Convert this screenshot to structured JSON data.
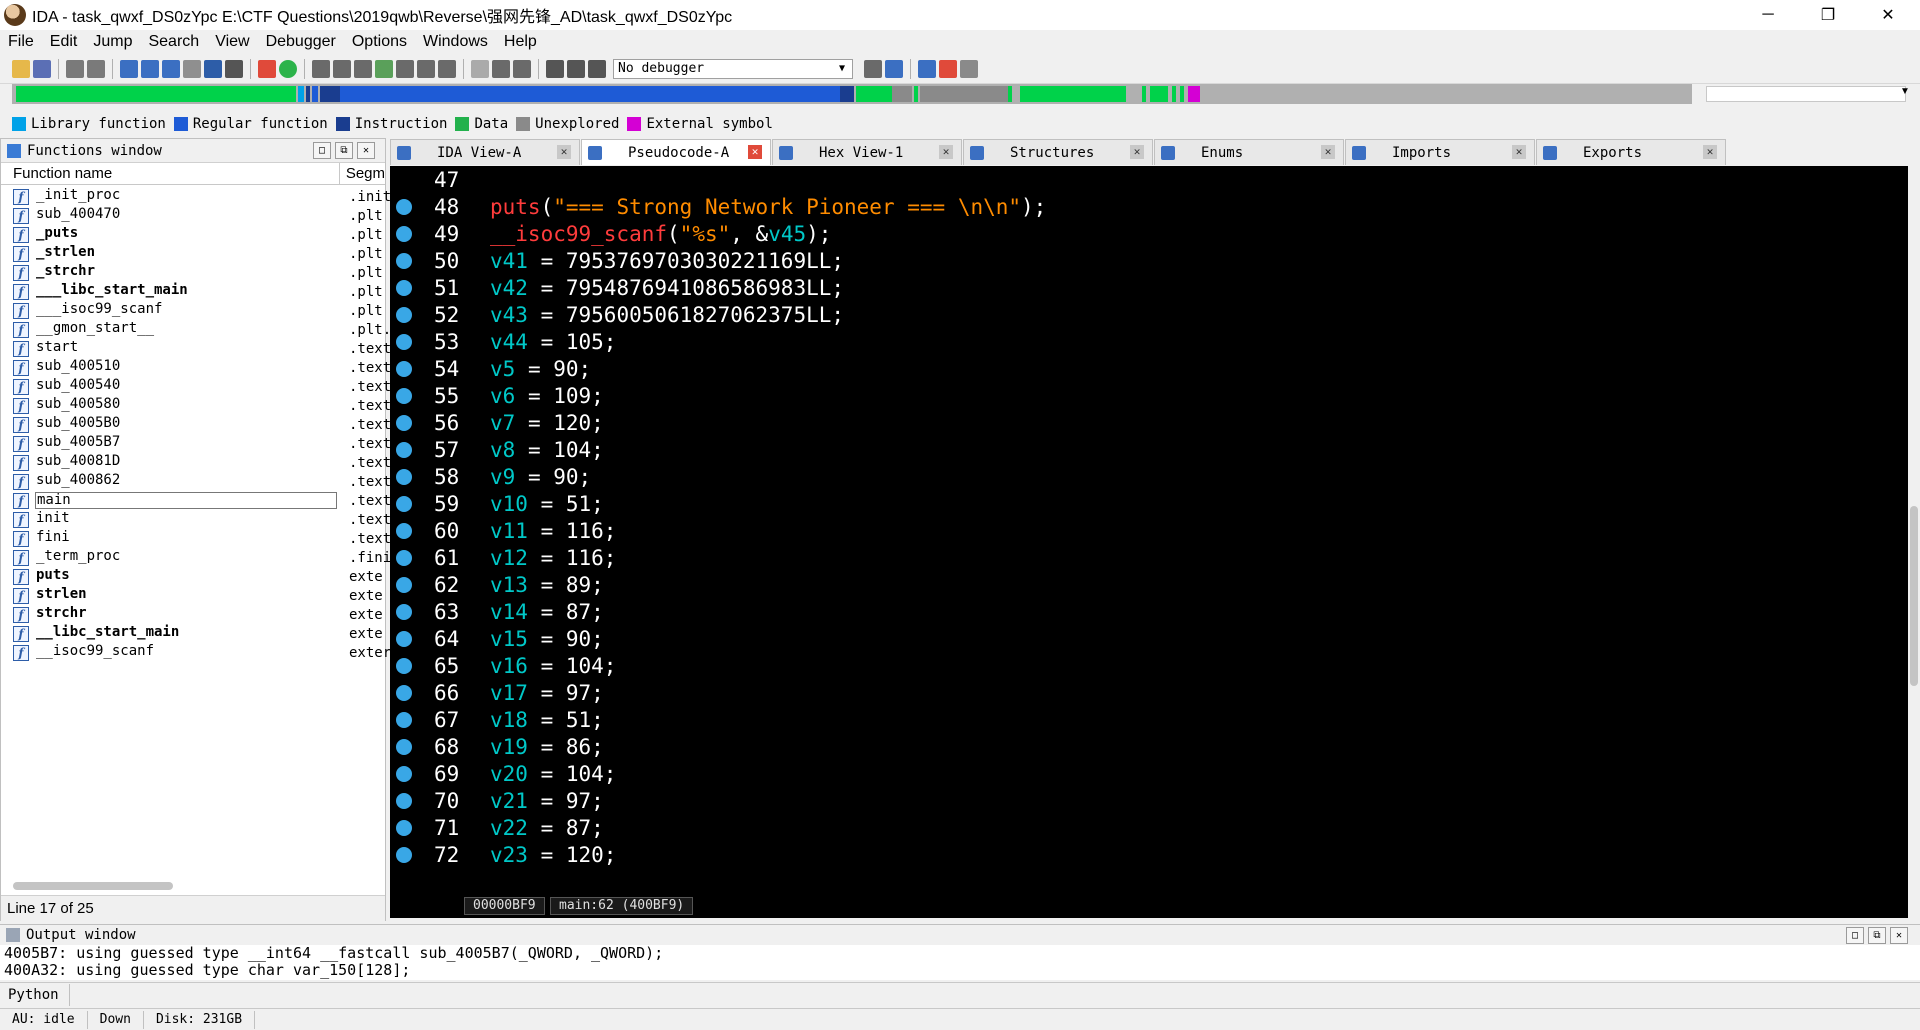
{
  "window": {
    "title": "IDA - task_qwxf_DS0zYpc E:\\CTF Questions\\2019qwb\\Reverse\\强网先锋_AD\\task_qwxf_DS0zYpc",
    "minimize": "─",
    "maximize": "❐",
    "close": "✕"
  },
  "menu": [
    "File",
    "Edit",
    "Jump",
    "Search",
    "View",
    "Debugger",
    "Options",
    "Windows",
    "Help"
  ],
  "toolbar": {
    "debugger_selected": "No debugger"
  },
  "legend": [
    {
      "label": "Library function",
      "color": "#00a2e8"
    },
    {
      "label": "Regular function",
      "color": "#1e5bd6"
    },
    {
      "label": "Instruction",
      "color": "#1a3d8f"
    },
    {
      "label": "Data",
      "color": "#22b14c"
    },
    {
      "label": "Unexplored",
      "color": "#8a8a8a"
    },
    {
      "label": "External symbol",
      "color": "#d400d4"
    }
  ],
  "functions_window": {
    "title": "Functions window",
    "col_name": "Function name",
    "col_segment": "Segm",
    "status": "Line 17 of 25",
    "rows": [
      {
        "name": "_init_proc",
        "seg": ".init",
        "bold": false
      },
      {
        "name": "sub_400470",
        "seg": ".plt",
        "bold": false
      },
      {
        "name": "_puts",
        "seg": ".plt",
        "bold": true
      },
      {
        "name": "_strlen",
        "seg": ".plt",
        "bold": true
      },
      {
        "name": "_strchr",
        "seg": ".plt",
        "bold": true
      },
      {
        "name": "___libc_start_main",
        "seg": ".plt",
        "bold": true
      },
      {
        "name": "___isoc99_scanf",
        "seg": ".plt",
        "bold": false
      },
      {
        "name": "__gmon_start__",
        "seg": ".plt.",
        "bold": false
      },
      {
        "name": "start",
        "seg": ".text",
        "bold": false
      },
      {
        "name": "sub_400510",
        "seg": ".text",
        "bold": false
      },
      {
        "name": "sub_400540",
        "seg": ".text",
        "bold": false
      },
      {
        "name": "sub_400580",
        "seg": ".text",
        "bold": false
      },
      {
        "name": "sub_4005B0",
        "seg": ".text",
        "bold": false
      },
      {
        "name": "sub_4005B7",
        "seg": ".text",
        "bold": false
      },
      {
        "name": "sub_40081D",
        "seg": ".text",
        "bold": false
      },
      {
        "name": "sub_400862",
        "seg": ".text",
        "bold": false
      },
      {
        "name": "main",
        "seg": ".text",
        "bold": false,
        "selected": true
      },
      {
        "name": "init",
        "seg": ".text",
        "bold": false
      },
      {
        "name": "fini",
        "seg": ".text",
        "bold": false
      },
      {
        "name": "_term_proc",
        "seg": ".fini",
        "bold": false
      },
      {
        "name": "puts",
        "seg": "exte",
        "bold": true
      },
      {
        "name": "strlen",
        "seg": "exte",
        "bold": true
      },
      {
        "name": "strchr",
        "seg": "exte",
        "bold": true
      },
      {
        "name": "__libc_start_main",
        "seg": "exte",
        "bold": true
      },
      {
        "name": "__isoc99_scanf",
        "seg": "exter",
        "bold": false
      }
    ]
  },
  "tabs": [
    {
      "label": "IDA View-A",
      "active": false
    },
    {
      "label": "Pseudocode-A",
      "active": true
    },
    {
      "label": "Hex View-1",
      "active": false
    },
    {
      "label": "Structures",
      "active": false
    },
    {
      "label": "Enums",
      "active": false
    },
    {
      "label": "Imports",
      "active": false
    },
    {
      "label": "Exports",
      "active": false
    }
  ],
  "colors": {
    "func": "#ff3c3c",
    "string": "#ff8c00",
    "var": "#00c8c8",
    "plain": "#ffffff",
    "number": "#ffffff"
  },
  "code_lines": [
    {
      "n": "47",
      "bp": false,
      "tokens": []
    },
    {
      "n": "48",
      "bp": true,
      "tokens": [
        [
          "puts",
          "func"
        ],
        [
          "(",
          "plain"
        ],
        [
          "\"=== Strong Network Pioneer === \\n\\n\"",
          "string"
        ],
        [
          ");",
          "plain"
        ]
      ]
    },
    {
      "n": "49",
      "bp": true,
      "tokens": [
        [
          "__isoc99_scanf",
          "func"
        ],
        [
          "(",
          "plain"
        ],
        [
          "\"%s\"",
          "string"
        ],
        [
          ", &",
          "plain"
        ],
        [
          "v45",
          "var"
        ],
        [
          ");",
          "plain"
        ]
      ]
    },
    {
      "n": "50",
      "bp": true,
      "tokens": [
        [
          "v41",
          "var"
        ],
        [
          " = 7953769703030221169LL;",
          "plain"
        ]
      ]
    },
    {
      "n": "51",
      "bp": true,
      "tokens": [
        [
          "v42",
          "var"
        ],
        [
          " = 7954876941086586983LL;",
          "plain"
        ]
      ]
    },
    {
      "n": "52",
      "bp": true,
      "tokens": [
        [
          "v43",
          "var"
        ],
        [
          " = 7956005061827062375LL;",
          "plain"
        ]
      ]
    },
    {
      "n": "53",
      "bp": true,
      "tokens": [
        [
          "v44",
          "var"
        ],
        [
          " = 105;",
          "plain"
        ]
      ]
    },
    {
      "n": "54",
      "bp": true,
      "tokens": [
        [
          "v5",
          "var"
        ],
        [
          " = 90;",
          "plain"
        ]
      ]
    },
    {
      "n": "55",
      "bp": true,
      "tokens": [
        [
          "v6",
          "var"
        ],
        [
          " = 109;",
          "plain"
        ]
      ]
    },
    {
      "n": "56",
      "bp": true,
      "tokens": [
        [
          "v7",
          "var"
        ],
        [
          " = 120;",
          "plain"
        ]
      ]
    },
    {
      "n": "57",
      "bp": true,
      "tokens": [
        [
          "v8",
          "var"
        ],
        [
          " = 104;",
          "plain"
        ]
      ]
    },
    {
      "n": "58",
      "bp": true,
      "tokens": [
        [
          "v9",
          "var"
        ],
        [
          " = 90;",
          "plain"
        ]
      ]
    },
    {
      "n": "59",
      "bp": true,
      "tokens": [
        [
          "v10",
          "var"
        ],
        [
          " = 51;",
          "plain"
        ]
      ]
    },
    {
      "n": "60",
      "bp": true,
      "tokens": [
        [
          "v11",
          "var"
        ],
        [
          " = 116;",
          "plain"
        ]
      ]
    },
    {
      "n": "61",
      "bp": true,
      "tokens": [
        [
          "v12",
          "var"
        ],
        [
          " = 116;",
          "plain"
        ]
      ]
    },
    {
      "n": "62",
      "bp": true,
      "tokens": [
        [
          "v13",
          "var"
        ],
        [
          " = 89;",
          "plain"
        ]
      ]
    },
    {
      "n": "63",
      "bp": true,
      "tokens": [
        [
          "v14",
          "var"
        ],
        [
          " = 87;",
          "plain"
        ]
      ]
    },
    {
      "n": "64",
      "bp": true,
      "tokens": [
        [
          "v15",
          "var"
        ],
        [
          " = 90;",
          "plain"
        ]
      ]
    },
    {
      "n": "65",
      "bp": true,
      "tokens": [
        [
          "v16",
          "var"
        ],
        [
          " = 104;",
          "plain"
        ]
      ]
    },
    {
      "n": "66",
      "bp": true,
      "tokens": [
        [
          "v17",
          "var"
        ],
        [
          " = 97;",
          "plain"
        ]
      ]
    },
    {
      "n": "67",
      "bp": true,
      "tokens": [
        [
          "v18",
          "var"
        ],
        [
          " = 51;",
          "plain"
        ]
      ]
    },
    {
      "n": "68",
      "bp": true,
      "tokens": [
        [
          "v19",
          "var"
        ],
        [
          " = 86;",
          "plain"
        ]
      ]
    },
    {
      "n": "69",
      "bp": true,
      "tokens": [
        [
          "v20",
          "var"
        ],
        [
          " = 104;",
          "plain"
        ]
      ]
    },
    {
      "n": "70",
      "bp": true,
      "tokens": [
        [
          "v21",
          "var"
        ],
        [
          " = 97;",
          "plain"
        ]
      ]
    },
    {
      "n": "71",
      "bp": true,
      "tokens": [
        [
          "v22",
          "var"
        ],
        [
          " = 87;",
          "plain"
        ]
      ]
    },
    {
      "n": "72",
      "bp": true,
      "tokens": [
        [
          "v23",
          "var"
        ],
        [
          " = 120;",
          "plain"
        ]
      ]
    }
  ],
  "code_status": {
    "address": "00000BF9",
    "location": "main:62 (400BF9)"
  },
  "output_window": {
    "title": "Output window",
    "lines": [
      "4005B7: using guessed type __int64 __fastcall sub_4005B7(_QWORD, _QWORD);",
      "400A32: using guessed type char var_150[128];"
    ]
  },
  "python_label": "Python",
  "statusbar": {
    "au": "AU:  idle",
    "dir": "Down",
    "disk": "Disk: 231GB"
  }
}
